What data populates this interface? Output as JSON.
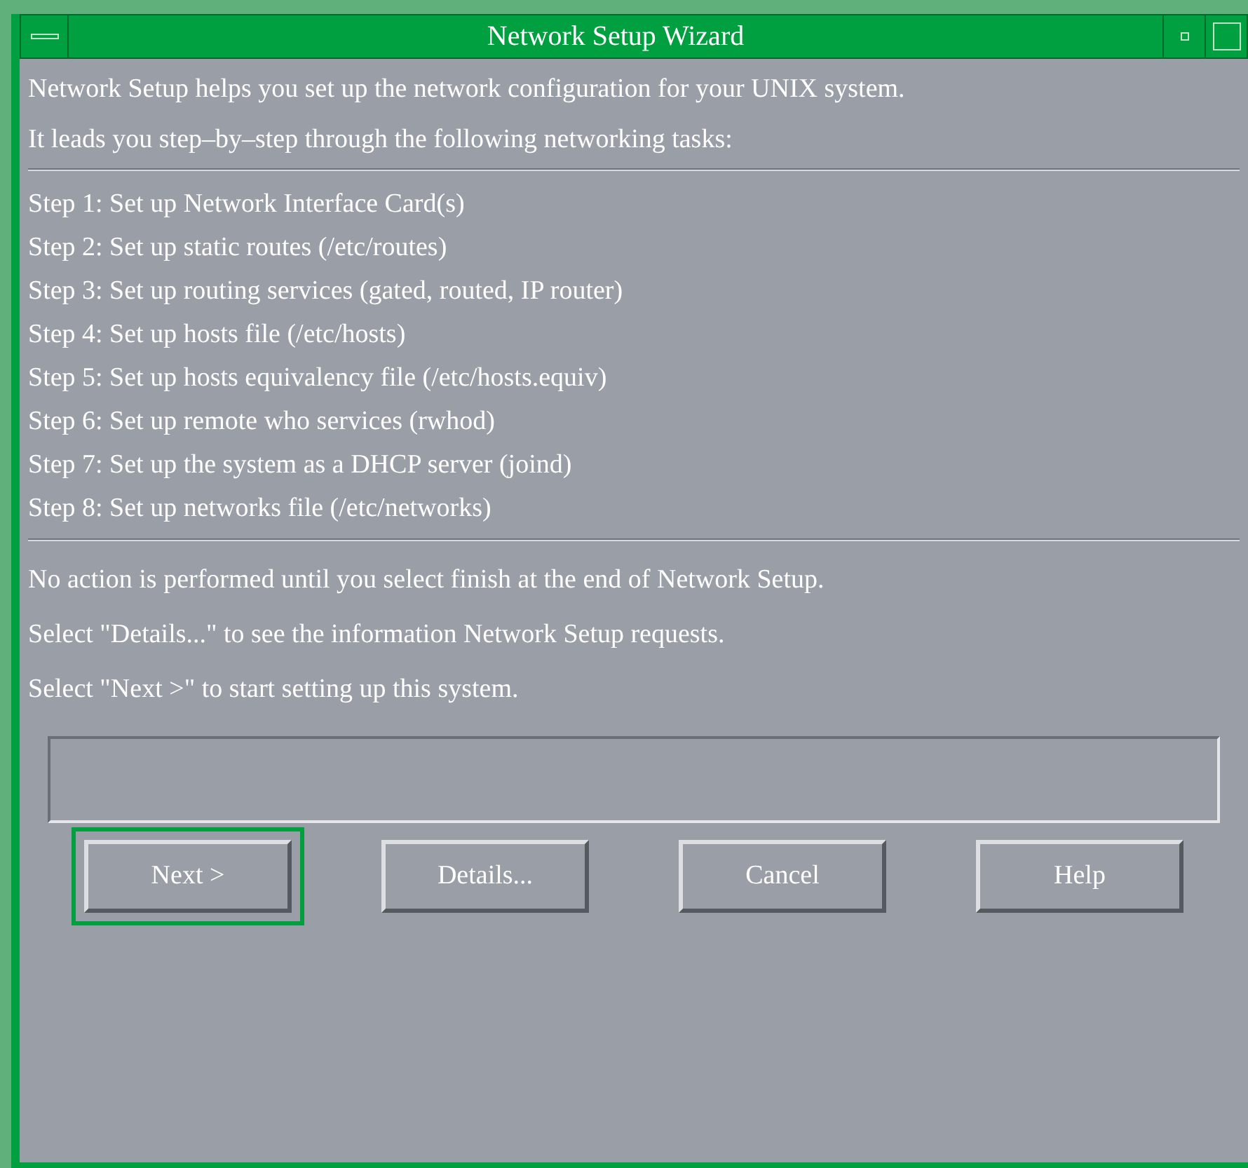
{
  "window": {
    "title": "Network Setup Wizard"
  },
  "intro": [
    "Network Setup helps you set up the network configuration for your UNIX system.",
    "It leads you step–by–step through the following networking tasks:"
  ],
  "steps": [
    "Step 1: Set up Network Interface Card(s)",
    "Step 2: Set up static routes (/etc/routes)",
    "Step 3: Set up routing services (gated, routed, IP router)",
    "Step 4: Set up hosts file (/etc/hosts)",
    "Step 5: Set up hosts equivalency file (/etc/hosts.equiv)",
    "Step 6: Set up remote who services (rwhod)",
    "Step 7: Set up the system as a DHCP server (joind)",
    "Step 8: Set up networks file (/etc/networks)"
  ],
  "notes": [
    "No action is performed until you select finish at the end of Network Setup.",
    "Select \"Details...\" to see the information Network Setup requests.",
    "Select \"Next >\" to start setting up this system."
  ],
  "buttons": [
    {
      "label": "Next >",
      "default": true
    },
    {
      "label": "Details...",
      "default": false
    },
    {
      "label": "Cancel",
      "default": false
    },
    {
      "label": "Help",
      "default": false
    }
  ]
}
